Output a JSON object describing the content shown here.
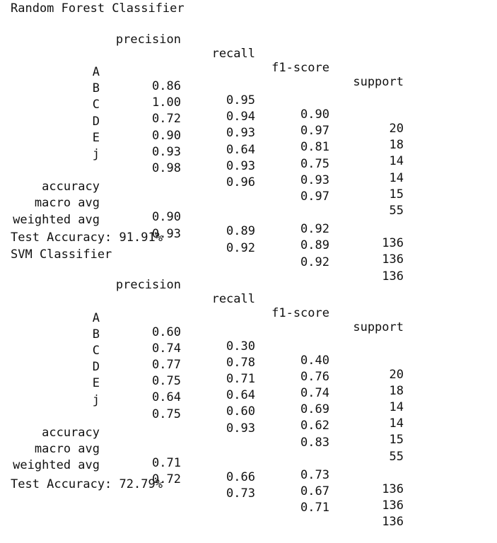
{
  "reports": [
    {
      "title": "Random Forest Classifier",
      "headers": [
        "precision",
        "recall",
        "f1-score",
        "support"
      ],
      "rows": [
        {
          "label": "A",
          "precision": "0.86",
          "recall": "0.95",
          "f1": "0.90",
          "support": "20"
        },
        {
          "label": "B",
          "precision": "1.00",
          "recall": "0.94",
          "f1": "0.97",
          "support": "18"
        },
        {
          "label": "C",
          "precision": "0.72",
          "recall": "0.93",
          "f1": "0.81",
          "support": "14"
        },
        {
          "label": "D",
          "precision": "0.90",
          "recall": "0.64",
          "f1": "0.75",
          "support": "14"
        },
        {
          "label": "E",
          "precision": "0.93",
          "recall": "0.93",
          "f1": "0.93",
          "support": "15"
        },
        {
          "label": "j",
          "precision": "0.98",
          "recall": "0.96",
          "f1": "0.97",
          "support": "55"
        }
      ],
      "summary": [
        {
          "label": "accuracy",
          "precision": "",
          "recall": "",
          "f1": "0.92",
          "support": "136"
        },
        {
          "label": "macro avg",
          "precision": "0.90",
          "recall": "0.89",
          "f1": "0.89",
          "support": "136"
        },
        {
          "label": "weighted avg",
          "precision": "0.93",
          "recall": "0.92",
          "f1": "0.92",
          "support": "136"
        }
      ],
      "test_accuracy": "Test Accuracy: 91.91%"
    },
    {
      "title": "SVM Classifier",
      "headers": [
        "precision",
        "recall",
        "f1-score",
        "support"
      ],
      "rows": [
        {
          "label": "A",
          "precision": "0.60",
          "recall": "0.30",
          "f1": "0.40",
          "support": "20"
        },
        {
          "label": "B",
          "precision": "0.74",
          "recall": "0.78",
          "f1": "0.76",
          "support": "18"
        },
        {
          "label": "C",
          "precision": "0.77",
          "recall": "0.71",
          "f1": "0.74",
          "support": "14"
        },
        {
          "label": "D",
          "precision": "0.75",
          "recall": "0.64",
          "f1": "0.69",
          "support": "14"
        },
        {
          "label": "E",
          "precision": "0.64",
          "recall": "0.60",
          "f1": "0.62",
          "support": "15"
        },
        {
          "label": "j",
          "precision": "0.75",
          "recall": "0.93",
          "f1": "0.83",
          "support": "55"
        }
      ],
      "summary": [
        {
          "label": "accuracy",
          "precision": "",
          "recall": "",
          "f1": "0.73",
          "support": "136"
        },
        {
          "label": "macro avg",
          "precision": "0.71",
          "recall": "0.66",
          "f1": "0.67",
          "support": "136"
        },
        {
          "label": "weighted avg",
          "precision": "0.72",
          "recall": "0.73",
          "f1": "0.71",
          "support": "136"
        }
      ],
      "test_accuracy": "Test Accuracy: 72.79%"
    }
  ]
}
